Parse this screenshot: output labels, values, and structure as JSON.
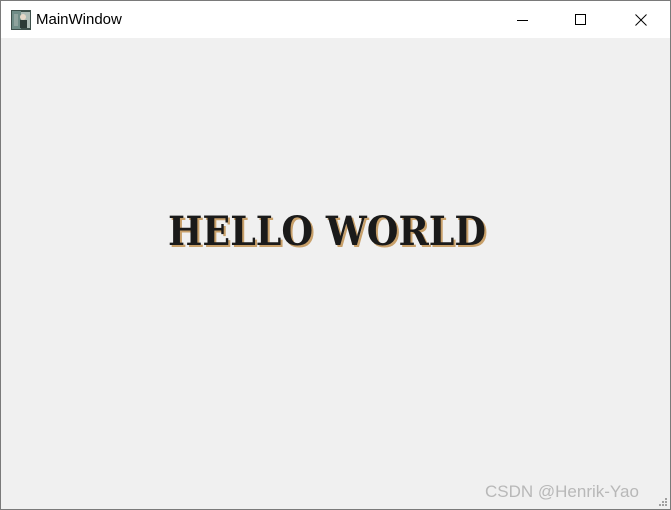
{
  "window": {
    "title": "MainWindow",
    "controls": {
      "minimize": "minimize-icon",
      "maximize": "maximize-icon",
      "close": "close-icon"
    }
  },
  "content": {
    "headline": "HELLO WORLD",
    "headline_color": "#1a1a1a",
    "headline_shadow_color": "#c8a06a"
  },
  "watermark": {
    "text": "CSDN @Henrik-Yao"
  },
  "colors": {
    "titlebar": "#ffffff",
    "client_background": "#f0f0f0",
    "border": "#7a7a7a"
  }
}
